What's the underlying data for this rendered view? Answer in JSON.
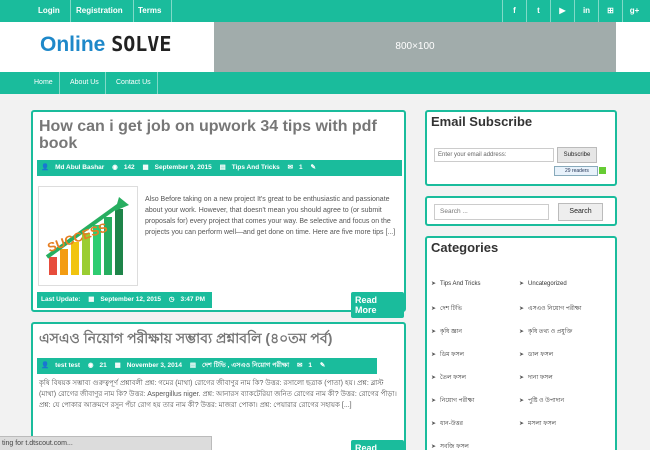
{
  "topbar": {
    "links": [
      "Login",
      "Registration",
      "Terms"
    ],
    "social": [
      "f",
      "t",
      "▶",
      "in",
      "⊞",
      "g+"
    ]
  },
  "logo": {
    "part1": "Online",
    "part2": "SOLVE"
  },
  "banner": {
    "text": "800×100"
  },
  "nav": {
    "items": [
      "Home",
      "About Us",
      "Contact Us"
    ]
  },
  "post1": {
    "title": "How can i get job on upwork 34 tips with pdf book",
    "author": "Md Abul Bashar",
    "views": "142",
    "date": "September 9, 2015",
    "category": "Tips And Tricks",
    "comments": "1",
    "excerpt": "Also Before taking on a new project It's great to be enthusiastic and passionate about your work. However, that doesn't mean you should agree to (or submit proposals for) every project that comes your way. Be selective and focus on the projects you can perform well—and get done on time. Here are five more tips [...]",
    "update_label": "Last Update:",
    "update_date": "September 12, 2015",
    "update_time": "3:47 PM",
    "readmore": "Read More",
    "image_word": "SUCCESS"
  },
  "post2": {
    "title": "এসএও নিয়োগ পরীক্ষায় সম্ভাব্য প্রশ্নাবলি (৪০তম পর্ব)",
    "author": "test test",
    "views": "21",
    "date": "November 3, 2014",
    "category": "দেশ টিভি , এসএও নিয়োগ পরীক্ষা",
    "comments": "1",
    "excerpt": "কৃষি বিষয়ক সম্ভাব্য গুরুত্বপূর্ণ প্রশ্নাবলী প্রশ্ন: গমের (মাথা) রোগের জীবাণুর নাম কি? উত্তর: রসালো ছত্রাক (পাতা) হয়। প্রশ্ন: ব্লাস্ট (মাথা) রোগের জীবাণুর নাম কি? উত্তর: Aspergillus niger. প্রশ্ন: আনারস ব্যাকটেরিয়া জনিত রোগের নাম কী? উত্তর: রোগের পীড়া। প্রশ্ন: যে পোকার আক্রমণে রসুন পঁচা রোগ হয় তার নাম কী? উত্তর: মাজরা পোকা। প্রশ্ন: পেয়ারার রোগের সহায়ক [...]",
    "readmore": "Read More"
  },
  "email": {
    "title": "Email Subscribe",
    "placeholder": "Enter your email address:",
    "button": "Subscribe",
    "feed_count": "29",
    "feed_label": "readers"
  },
  "search": {
    "placeholder": "Search ...",
    "button": "Search"
  },
  "categories": {
    "title": "Categories",
    "left": [
      "Tips And Tricks",
      "দেশ টিভি",
      "কৃষি জ্ঞান",
      "ডিম ফসল",
      "তৈল ফসল",
      "নিয়োগ পরীক্ষা",
      "ধান-উত্তর",
      "সবজি ফসল"
    ],
    "right": [
      "Uncategorized",
      "এসএও নিয়োগ পরীক্ষা",
      "কৃষি তথ্য ও প্রযুক্তি",
      "ডাল ফসল",
      "দানা ফসল",
      "পুষ্টি ও উপাদান",
      "মসলা ফসল"
    ]
  },
  "status": {
    "text": "ting for t.dtscout.com..."
  },
  "colors": {
    "accent": "#1abc9c",
    "logo_blue": "#1e88c9"
  }
}
